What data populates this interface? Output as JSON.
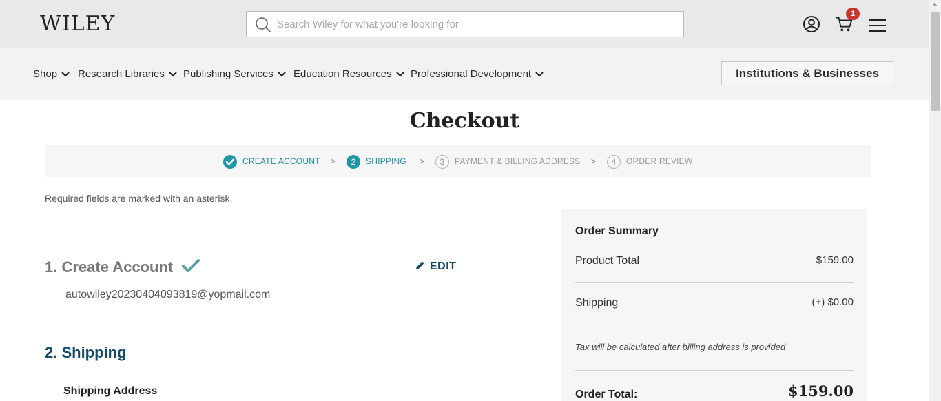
{
  "header": {
    "logo": "WILEY",
    "search_placeholder": "Search Wiley for what you're looking for",
    "cart_count": "1",
    "icons": [
      "search-icon",
      "account-icon",
      "cart-icon",
      "menu-icon"
    ]
  },
  "nav": {
    "items": [
      {
        "label": "Shop"
      },
      {
        "label": "Research Libraries"
      },
      {
        "label": "Publishing Services"
      },
      {
        "label": "Education Resources"
      },
      {
        "label": "Professional Development"
      }
    ],
    "institutions_button": "Institutions & Businesses"
  },
  "checkout": {
    "title": "Checkout",
    "steps": [
      {
        "number": "1",
        "label": "CREATE ACCOUNT",
        "state": "done"
      },
      {
        "number": "2",
        "label": "SHIPPING",
        "state": "active"
      },
      {
        "number": "3",
        "label": "PAYMENT & BILLING ADDRESS",
        "state": "todo"
      },
      {
        "number": "4",
        "label": "ORDER REVIEW",
        "state": "todo"
      }
    ],
    "step_separator": ">",
    "required_note": "Required fields are marked with an asterisk.",
    "section1": {
      "title": "1. Create Account",
      "edit_label": "EDIT",
      "email": "autowiley20230404093819@yopmail.com"
    },
    "section2": {
      "title": "2. Shipping",
      "shipping_address_label": "Shipping Address"
    }
  },
  "summary": {
    "title": "Order Summary",
    "product_total_label": "Product Total",
    "product_total_value": "$159.00",
    "shipping_label": "Shipping",
    "shipping_value": "(+) $0.00",
    "tax_note": "Tax will be calculated after billing address is provided",
    "order_total_label": "Order Total:",
    "order_total_value": "$159.00"
  },
  "colors": {
    "teal": "#1e97a8",
    "navy": "#124a6b",
    "badge": "#c8372d"
  }
}
